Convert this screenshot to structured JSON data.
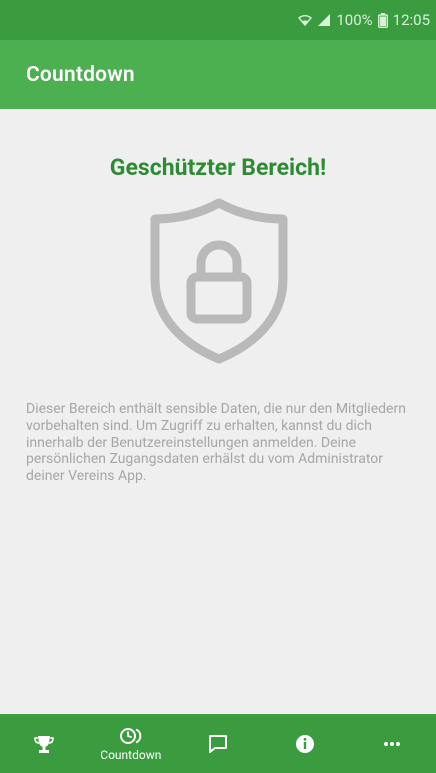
{
  "status_bar": {
    "battery": "100%",
    "time": "12:05",
    "icons": [
      "wifi-icon",
      "signal-icon",
      "battery-icon"
    ]
  },
  "app_bar": {
    "title": "Countdown"
  },
  "content": {
    "heading": "Geschützter Bereich!",
    "icon": "shield-lock-icon",
    "message": "Dieser Bereich enthält sensible Daten, die nur den Mitgliedern vorbehalten sind. Um Zugriff zu erhalten, kannst du dich innerhalb der Benutzereinstellungen anmelden. Deine persönlichen Zugangsdaten erhälst du vom Administrator deiner Vereins App."
  },
  "bottom_nav": {
    "items": [
      {
        "icon": "trophy-icon",
        "label": ""
      },
      {
        "icon": "countdown-icon",
        "label": "Countdown",
        "active": true
      },
      {
        "icon": "chat-icon",
        "label": ""
      },
      {
        "icon": "info-icon",
        "label": ""
      },
      {
        "icon": "more-icon",
        "label": ""
      }
    ]
  },
  "colors": {
    "status_bar": "#3a9c3e",
    "app_bar": "#4caf50",
    "heading": "#2e8b34",
    "background": "#efefef",
    "muted_text": "#a6a6a6"
  }
}
